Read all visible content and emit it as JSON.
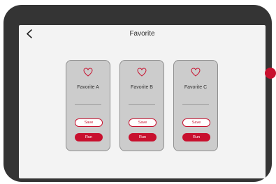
{
  "header": {
    "title": "Favorite",
    "back_icon": "chevron-left-icon"
  },
  "favorites": [
    {
      "label": "Favorite A",
      "icon": "heart-icon",
      "save_label": "Save",
      "run_label": "Run"
    },
    {
      "label": "Favorite B",
      "icon": "heart-icon",
      "save_label": "Save",
      "run_label": "Run"
    },
    {
      "label": "Favorite C",
      "icon": "heart-icon",
      "save_label": "Save",
      "run_label": "Run"
    }
  ],
  "colors": {
    "accent": "#c8102e",
    "device_frame": "#343434",
    "screen_background": "#f3f3f3",
    "card_background": "#cccccc",
    "card_border": "#8e8e8e"
  }
}
